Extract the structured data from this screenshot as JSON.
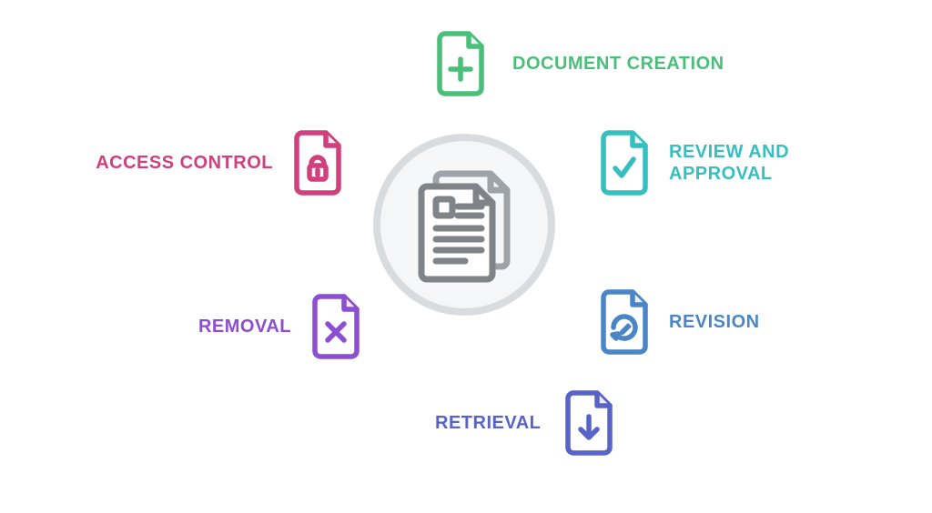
{
  "diagram": {
    "center_icon_name": "document-stack",
    "nodes": {
      "create": {
        "label": "DOCUMENT CREATION",
        "icon": "file-plus",
        "color": "#49bf7a"
      },
      "review": {
        "label": "REVIEW AND APPROVAL",
        "icon": "file-check",
        "color": "#36bfbf"
      },
      "revision": {
        "label": "REVISION",
        "icon": "file-edit",
        "color": "#4a86c5"
      },
      "retrieve": {
        "label": "RETRIEVAL",
        "icon": "file-download",
        "color": "#5763c9"
      },
      "removal": {
        "label": "REMOVAL",
        "icon": "file-remove",
        "color": "#8c4fd1"
      },
      "access": {
        "label": "ACCESS CONTROL",
        "icon": "file-lock",
        "color": "#d1407c"
      }
    },
    "colors": {
      "ring": "#d9dcdf",
      "center_icon": "#8a8f95",
      "background": "#ffffff"
    }
  }
}
